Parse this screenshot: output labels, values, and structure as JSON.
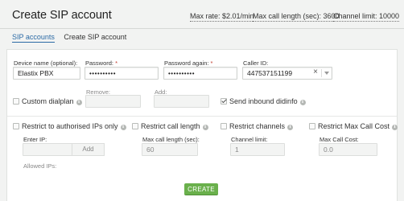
{
  "header": {
    "title": "Create SIP account",
    "max_rate": "Max rate: $2.01/min",
    "max_call_length": "Max call length (sec): 3600",
    "channel_limit": "Channel limit: 10000"
  },
  "tabs": [
    {
      "label": "SIP accounts",
      "active": true
    },
    {
      "label": "Create SIP account",
      "active": false
    }
  ],
  "form": {
    "device_name": {
      "label": "Device name (optional):",
      "value": "Elastix PBX"
    },
    "password": {
      "label": "Password:",
      "required_mark": "*",
      "value": "••••••••••"
    },
    "password_again": {
      "label": "Password again:",
      "required_mark": "*",
      "value": "••••••••••"
    },
    "caller_id": {
      "label": "Caller ID:",
      "value": "447537151199",
      "clear_glyph": "×"
    },
    "custom_dialplan": {
      "label": "Custom dialplan",
      "checked": false
    },
    "remove": {
      "label": "Remove:",
      "value": ""
    },
    "add": {
      "label": "Add:",
      "value": ""
    },
    "send_inbound_didinfo": {
      "label": "Send inbound didinfo",
      "checked": true
    },
    "restrict_ips": {
      "label": "Restrict to authorised IPs only",
      "checked": false
    },
    "enter_ip": {
      "label": "Enter IP:",
      "value": "",
      "add_label": "Add"
    },
    "allowed_ips": {
      "label": "Allowed IPs:"
    },
    "restrict_call_length": {
      "label": "Restrict call length",
      "checked": false
    },
    "max_call_length_sec": {
      "label": "Max call length (sec):",
      "value": "60"
    },
    "restrict_channels": {
      "label": "Restrict channels",
      "checked": false
    },
    "channel_limit": {
      "label": "Channel limit:",
      "value": "1"
    },
    "restrict_max_call_cost": {
      "label": "Restrict Max Call Cost",
      "checked": false
    },
    "max_call_cost": {
      "label": "Max Call Cost:",
      "value": "0.0"
    },
    "info_glyph": "i"
  },
  "create_button": "CREATE",
  "colors": {
    "accent_link": "#2b6aa5",
    "create_green": "#6ab04c",
    "required": "#c0392b"
  }
}
